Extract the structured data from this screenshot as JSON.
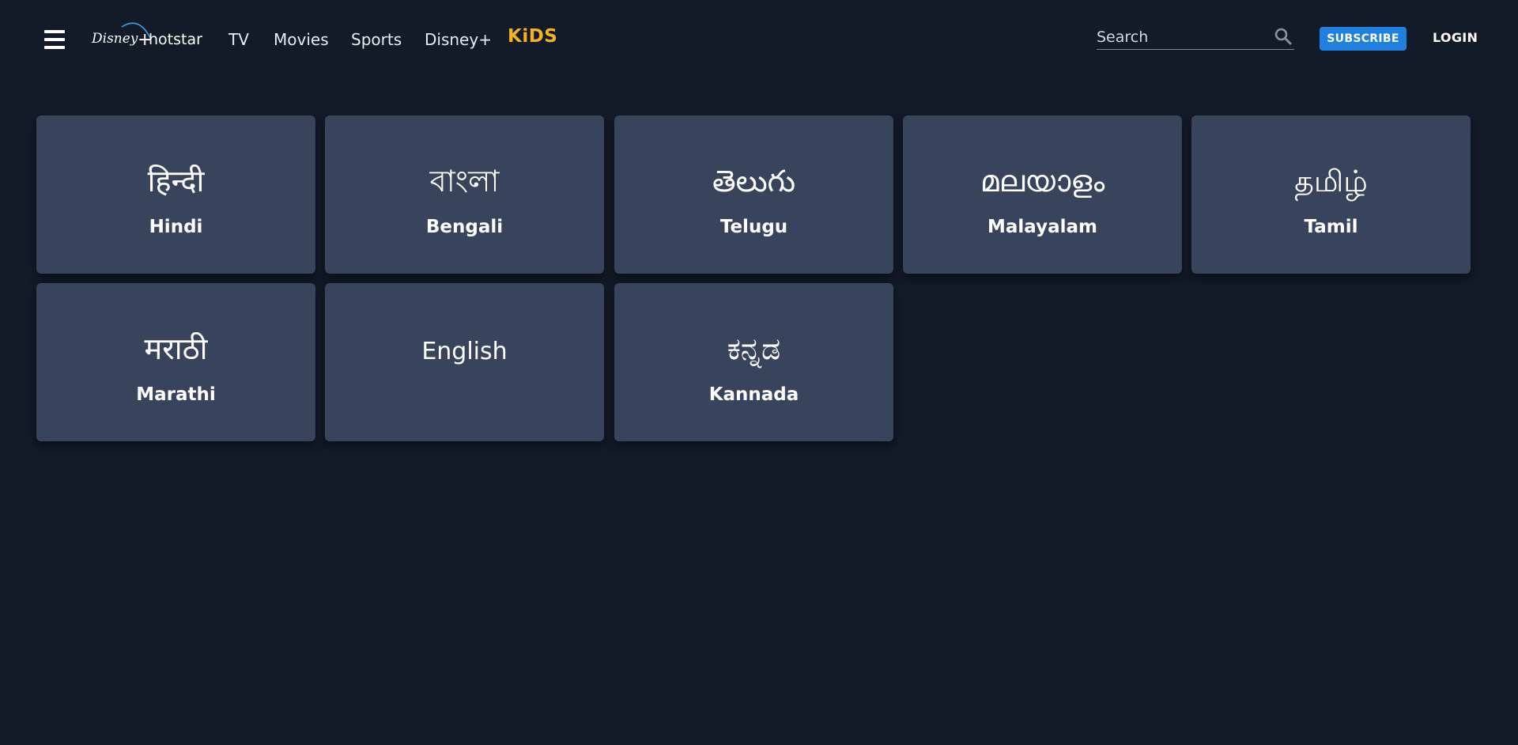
{
  "header": {
    "logo_text": "Disney+ hotstar",
    "nav": [
      {
        "label": "TV"
      },
      {
        "label": "Movies"
      },
      {
        "label": "Sports"
      },
      {
        "label": "Disney+"
      }
    ],
    "kids_label": "KiDS",
    "search": {
      "placeholder": "Search",
      "value": ""
    },
    "subscribe_label": "SUBSCRIBE",
    "login_label": "LOGIN"
  },
  "languages": [
    {
      "native": "हिन्दी",
      "label": "Hindi"
    },
    {
      "native": "বাংলা",
      "label": "Bengali"
    },
    {
      "native": "తెలుగు",
      "label": "Telugu"
    },
    {
      "native": "മലയാളം",
      "label": "Malayalam"
    },
    {
      "native": "தமிழ்",
      "label": "Tamil"
    },
    {
      "native": "मराठी",
      "label": "Marathi"
    },
    {
      "native": "English",
      "label": ""
    },
    {
      "native": "ಕನ್ನಡ",
      "label": "Kannada"
    }
  ],
  "colors": {
    "background": "#131a28",
    "card": "#38445c",
    "accent_blue": "#1f80e0",
    "kids_yellow": "#f4b320"
  }
}
